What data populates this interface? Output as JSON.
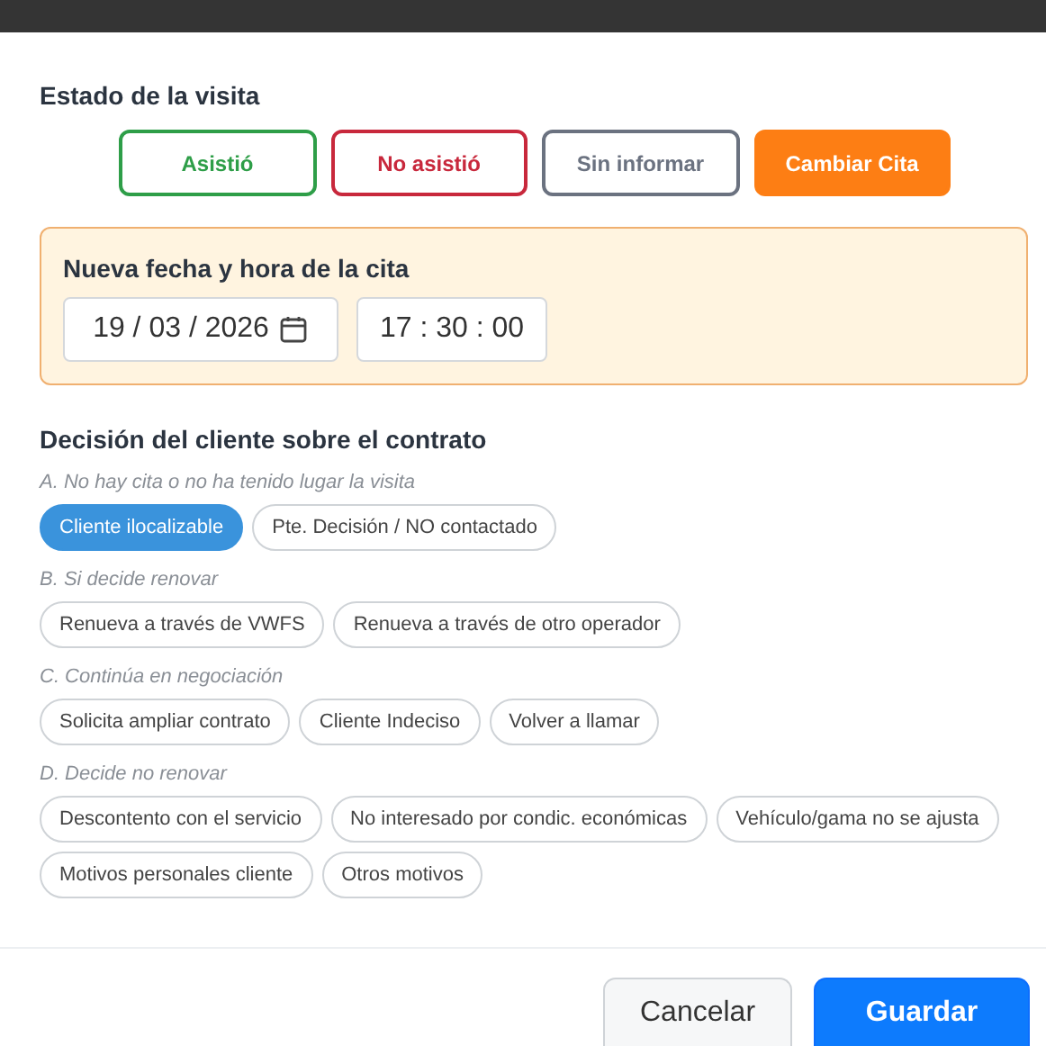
{
  "visit_status": {
    "title": "Estado de la visita",
    "options": [
      {
        "label": "Asistió",
        "color": "#2e9e48",
        "selected": false
      },
      {
        "label": "No asistió",
        "color": "#c8283c",
        "selected": false
      },
      {
        "label": "Sin informar",
        "color": "#6b7280",
        "selected": false
      },
      {
        "label": "Cambiar Cita",
        "color": "#fd7e14",
        "selected": true
      }
    ]
  },
  "new_appointment": {
    "title": "Nueva fecha y hora de la cita",
    "date": "19 / 03 / 2026",
    "time": "17 : 30 : 00"
  },
  "decision": {
    "title": "Decisión del cliente sobre el contrato",
    "groups": [
      {
        "label": "A. No hay cita o no ha tenido lugar la visita",
        "options": [
          {
            "label": "Cliente ilocalizable",
            "selected": true
          },
          {
            "label": "Pte. Decisión / NO contactado",
            "selected": false
          }
        ]
      },
      {
        "label": "B. Si decide renovar",
        "options": [
          {
            "label": "Renueva a través de VWFS",
            "selected": false
          },
          {
            "label": "Renueva a través de otro operador",
            "selected": false
          }
        ]
      },
      {
        "label": "C. Continúa en negociación",
        "options": [
          {
            "label": "Solicita ampliar contrato",
            "selected": false
          },
          {
            "label": "Cliente Indeciso",
            "selected": false
          },
          {
            "label": "Volver a llamar",
            "selected": false
          }
        ]
      },
      {
        "label": "D. Decide no renovar",
        "options": [
          {
            "label": "Descontento con el servicio",
            "selected": false
          },
          {
            "label": "No interesado por condic. económicas",
            "selected": false
          },
          {
            "label": "Vehículo/gama no se ajusta",
            "selected": false
          },
          {
            "label": "Motivos personales cliente",
            "selected": false
          },
          {
            "label": "Otros motivos",
            "selected": false
          }
        ]
      }
    ]
  },
  "footer": {
    "buttons": [
      {
        "label": "Cancelar",
        "kind": "secondary"
      },
      {
        "label": "Guardar",
        "kind": "primary"
      }
    ]
  }
}
